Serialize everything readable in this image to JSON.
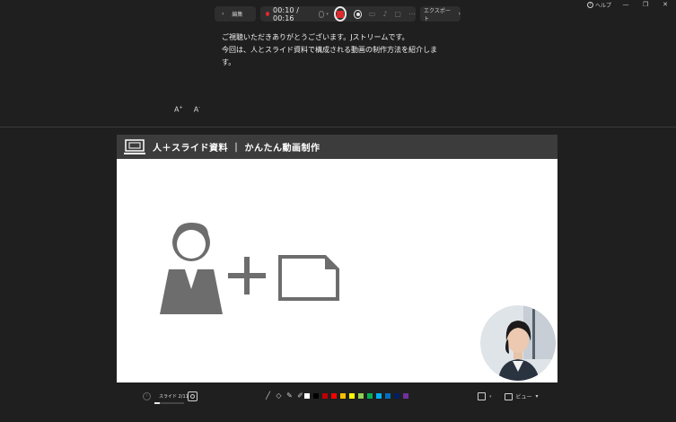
{
  "window": {
    "help_label": "ヘルプ",
    "minimize": "—",
    "restore": "❐",
    "close": "✕"
  },
  "toolbar": {
    "edit_label": "編集",
    "timer": "00:10 / 00:16",
    "export_label": "エクスポート"
  },
  "script": {
    "text": "ご視聴いただきありがとうございます。Jストリームです。\n今回は、人とスライド資料で構成される動画の制作方法を紹介します。"
  },
  "font_controls": {
    "increase": "A",
    "decrease": "A"
  },
  "slide": {
    "title": "人＋スライド資料 ｜ かんたん動画制作"
  },
  "bottom_bar": {
    "slide_counter": "スライド 2/11",
    "progress": 0.18,
    "view_label": "ビュー",
    "colors": [
      "#ffffff",
      "#000000",
      "#c00000",
      "#ff0000",
      "#ffc000",
      "#ffff00",
      "#92d050",
      "#00b050",
      "#00b0f0",
      "#0070c0",
      "#002060",
      "#7030a0"
    ]
  },
  "colors": {
    "record_red": "#e0282f",
    "slide_header": "#3c3c3c",
    "icon_gray": "#6d6d6d"
  }
}
